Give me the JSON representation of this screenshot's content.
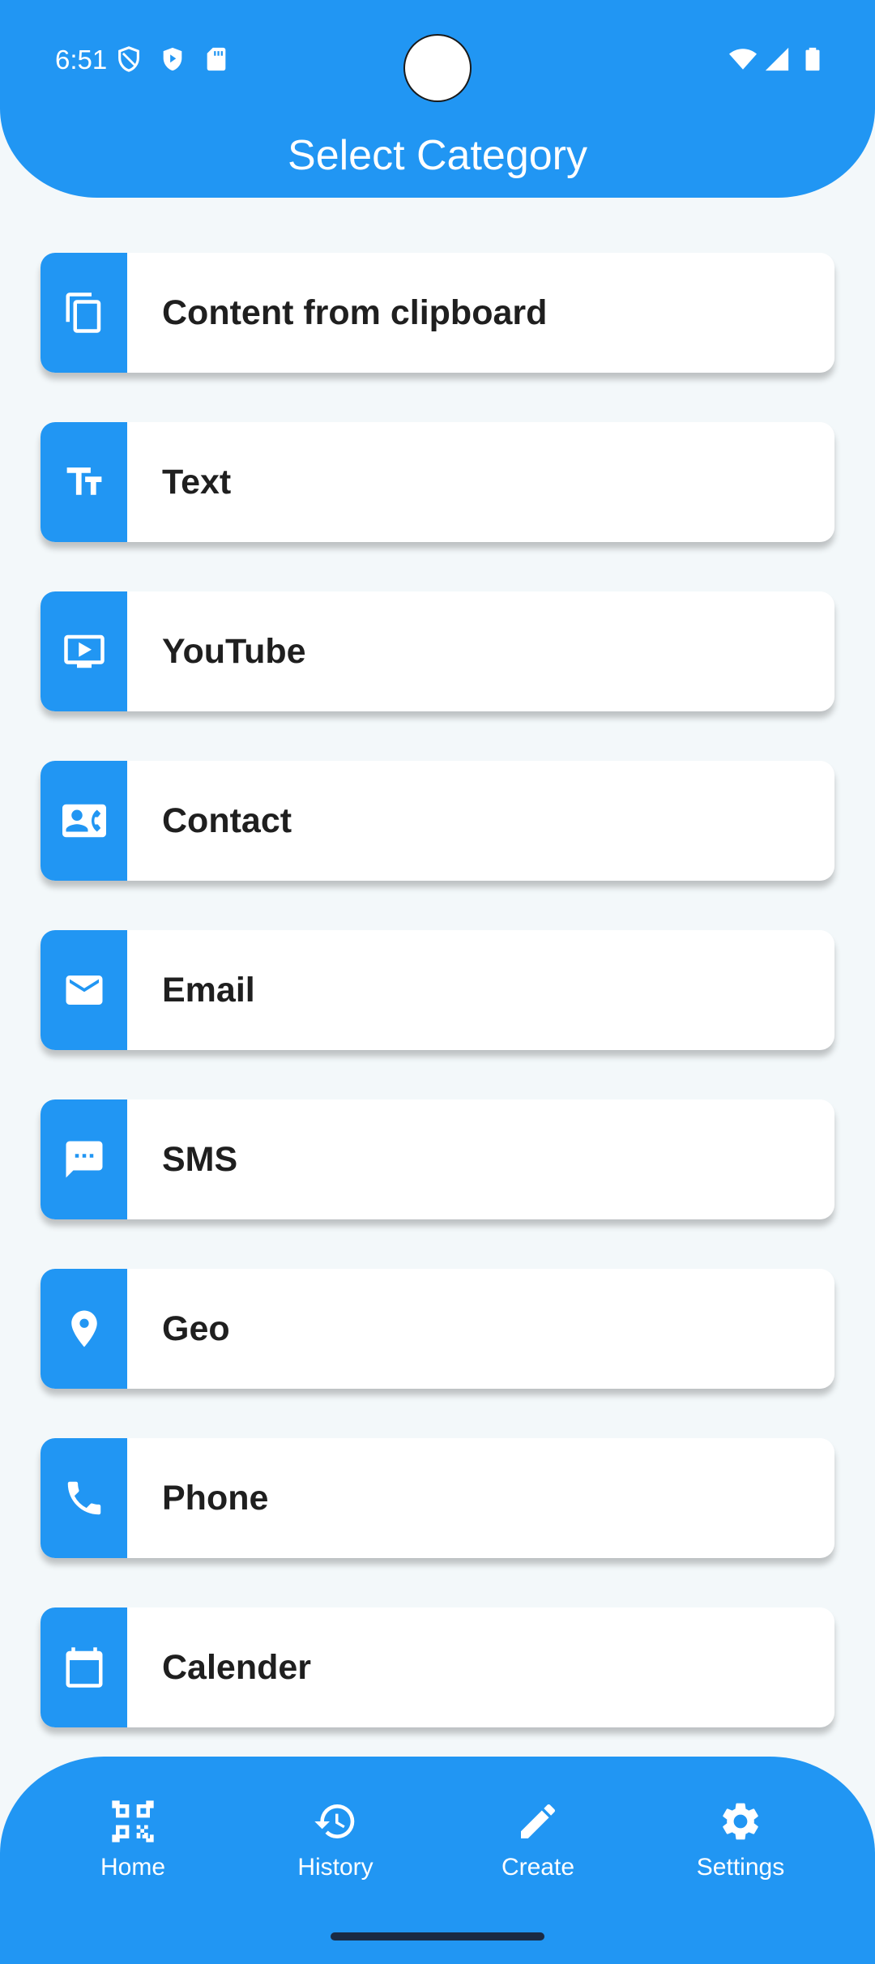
{
  "status_bar": {
    "time": "6:51"
  },
  "header": {
    "title": "Select Category"
  },
  "categories": [
    {
      "label": "Content from clipboard",
      "icon": "copy-icon"
    },
    {
      "label": "Text",
      "icon": "text-fields-icon"
    },
    {
      "label": "YouTube",
      "icon": "video-screen-icon"
    },
    {
      "label": "Contact",
      "icon": "contact-card-icon"
    },
    {
      "label": "Email",
      "icon": "email-icon"
    },
    {
      "label": "SMS",
      "icon": "sms-icon"
    },
    {
      "label": "Geo",
      "icon": "location-pin-icon"
    },
    {
      "label": "Phone",
      "icon": "phone-icon"
    },
    {
      "label": "Calender",
      "icon": "calendar-icon"
    }
  ],
  "bottom_nav": {
    "items": [
      {
        "label": "Home",
        "icon": "qr-code-icon"
      },
      {
        "label": "History",
        "icon": "history-icon"
      },
      {
        "label": "Create",
        "icon": "pencil-icon"
      },
      {
        "label": "Settings",
        "icon": "gear-icon"
      }
    ]
  },
  "colors": {
    "primary": "#2196F3",
    "background": "#F3F8FA",
    "card": "#FFFFFF",
    "text": "#1F1F1F"
  }
}
